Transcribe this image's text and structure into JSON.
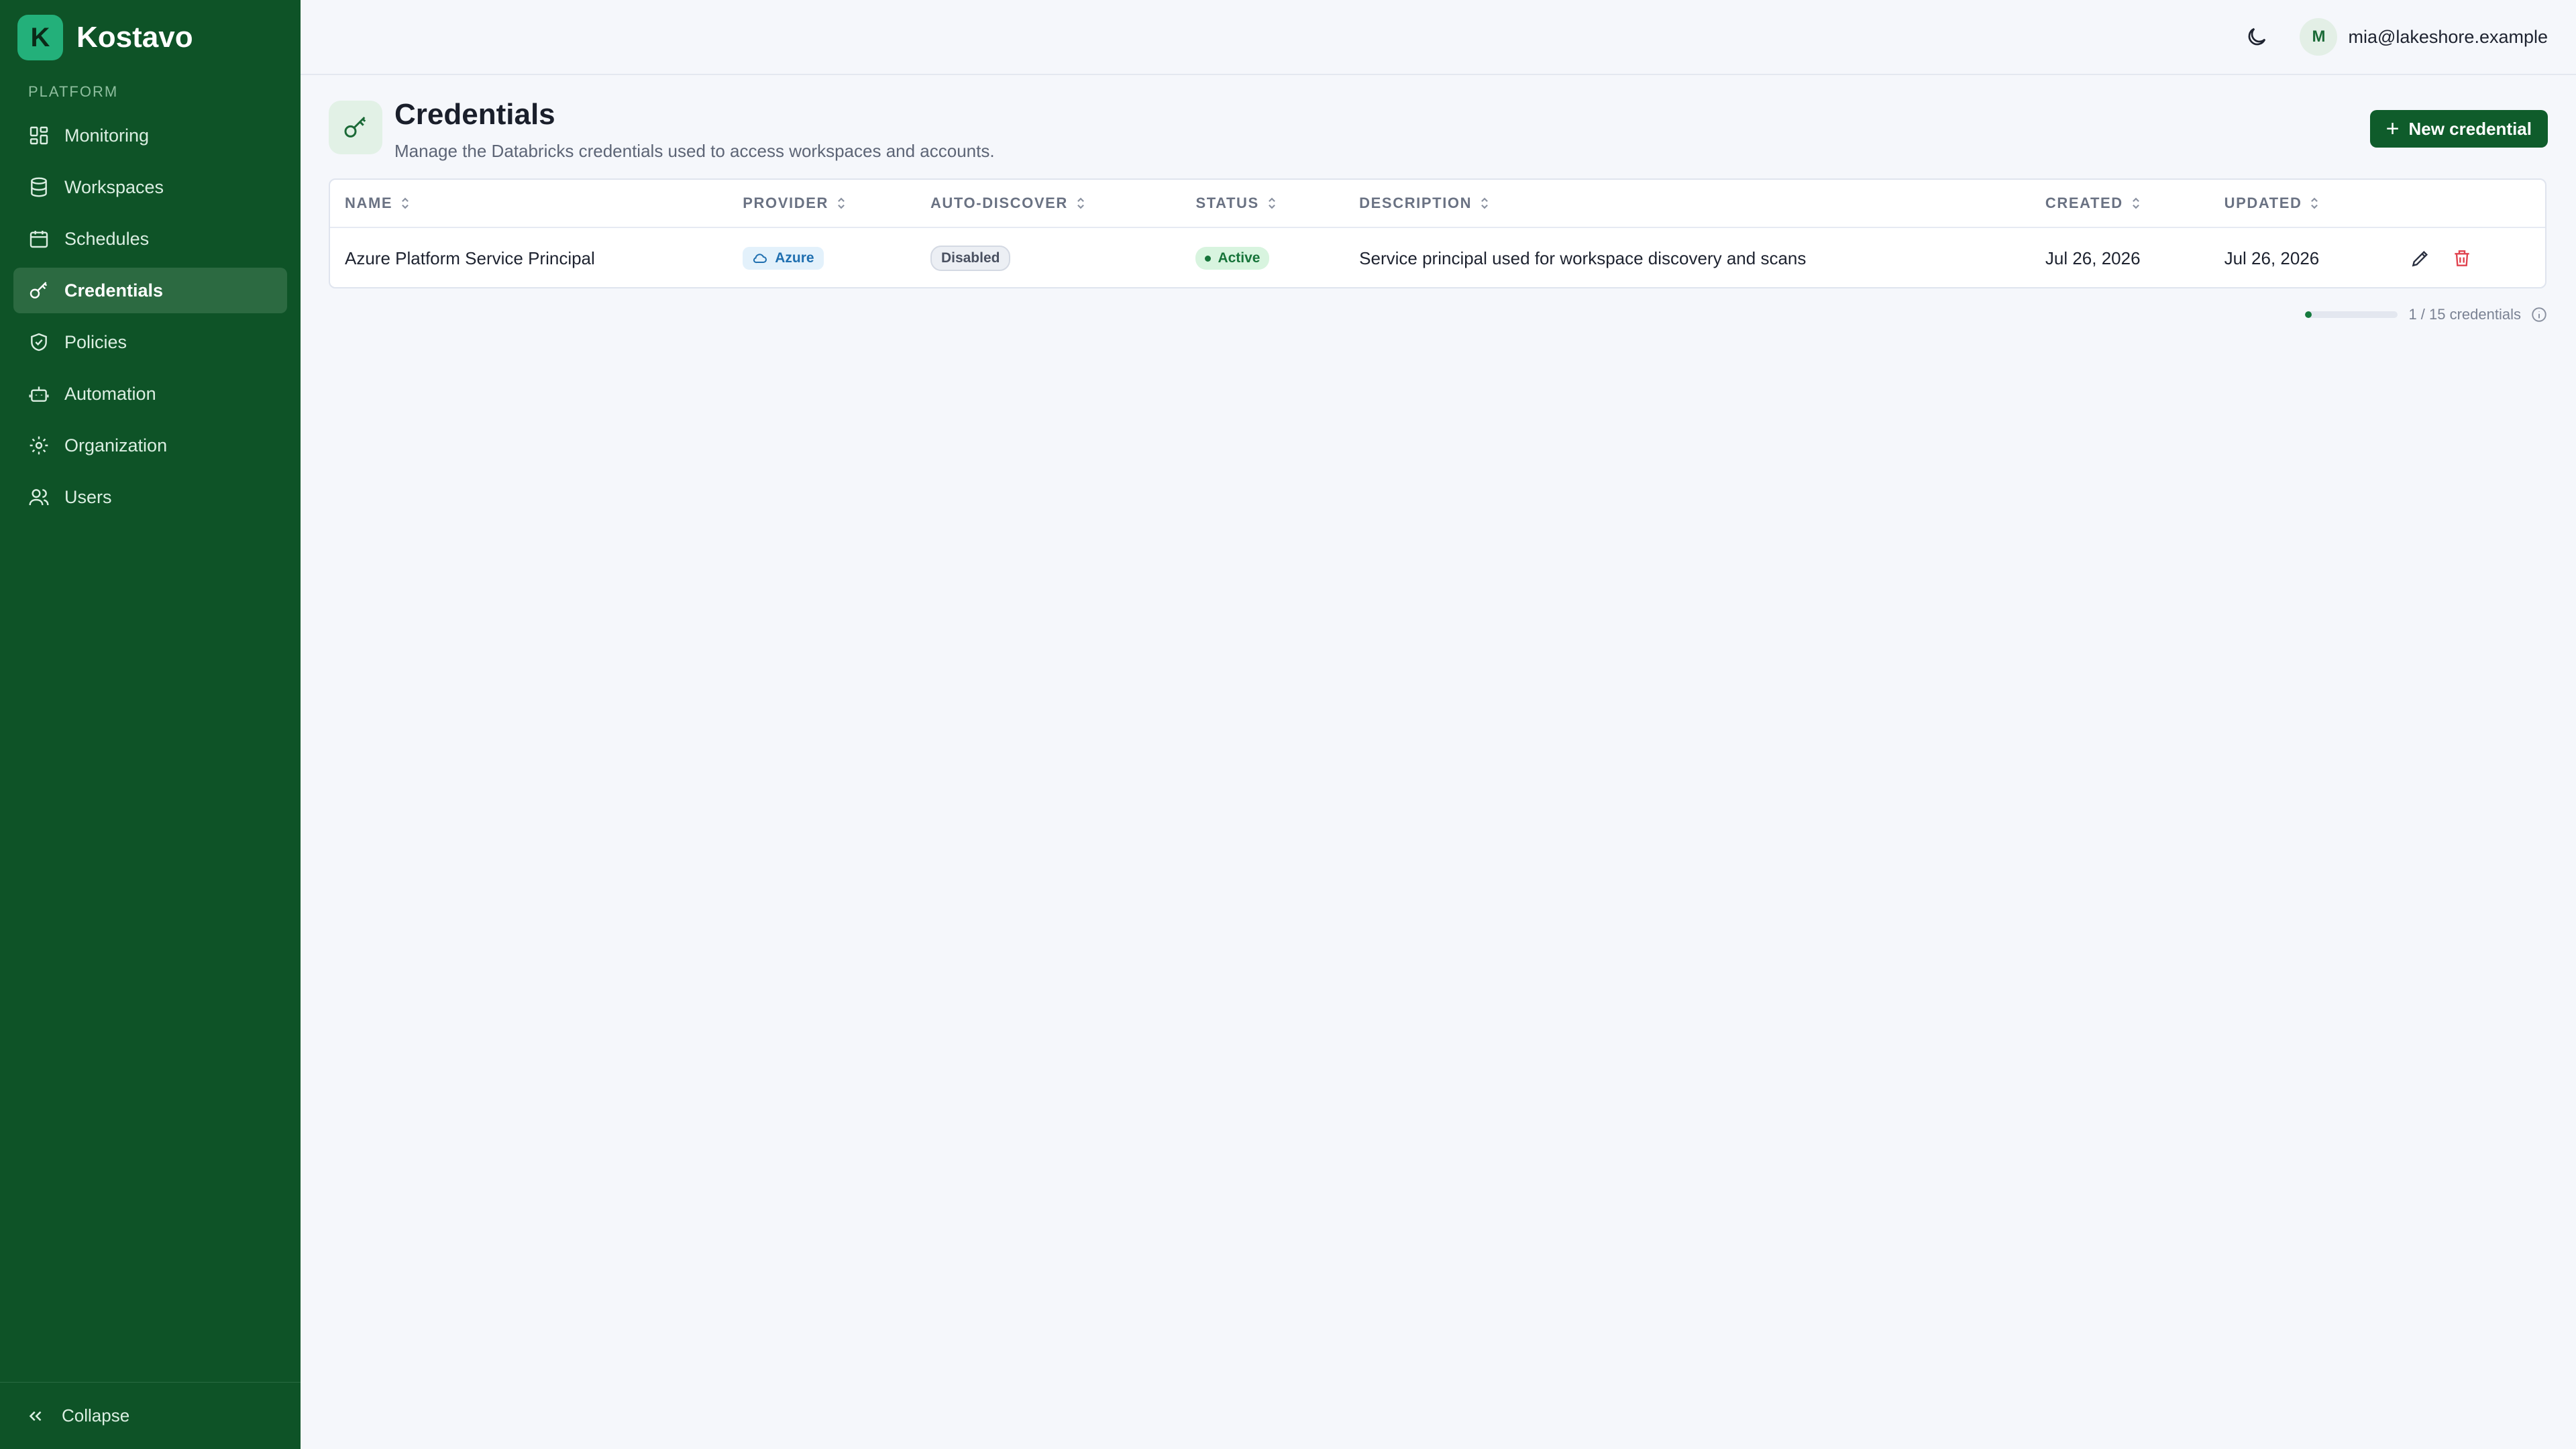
{
  "brand": {
    "logo_letter": "K",
    "name": "Kostavo",
    "accent": "#23b07a",
    "sidebar_bg": "#0e5327"
  },
  "sidebar": {
    "section_label": "PLATFORM",
    "items": [
      {
        "label": "Monitoring",
        "icon": "dashboard-icon"
      },
      {
        "label": "Workspaces",
        "icon": "database-icon"
      },
      {
        "label": "Schedules",
        "icon": "calendar-icon"
      },
      {
        "label": "Credentials",
        "icon": "key-icon",
        "active": true
      },
      {
        "label": "Policies",
        "icon": "shield-icon"
      },
      {
        "label": "Automation",
        "icon": "robot-icon"
      },
      {
        "label": "Organization",
        "icon": "gear-icon"
      },
      {
        "label": "Users",
        "icon": "users-icon"
      }
    ],
    "collapse_label": "Collapse"
  },
  "topbar": {
    "avatar_initial": "M",
    "user_email": "mia@lakeshore.example"
  },
  "page": {
    "title": "Credentials",
    "subtitle": "Manage the Databricks credentials used to access workspaces and accounts.",
    "new_button_label": "New credential"
  },
  "table": {
    "columns": [
      "NAME",
      "PROVIDER",
      "AUTO-DISCOVER",
      "STATUS",
      "DESCRIPTION",
      "CREATED",
      "UPDATED"
    ],
    "rows": [
      {
        "name": "Azure Platform Service Principal",
        "provider": "Azure",
        "auto_discover": "Disabled",
        "status": "Active",
        "description": "Service principal used for workspace discovery and scans",
        "created": "Jul 26, 2026",
        "updated": "Jul 26, 2026"
      }
    ]
  },
  "quota": {
    "text": "1 / 15 credentials",
    "used": 1,
    "limit": 15
  }
}
